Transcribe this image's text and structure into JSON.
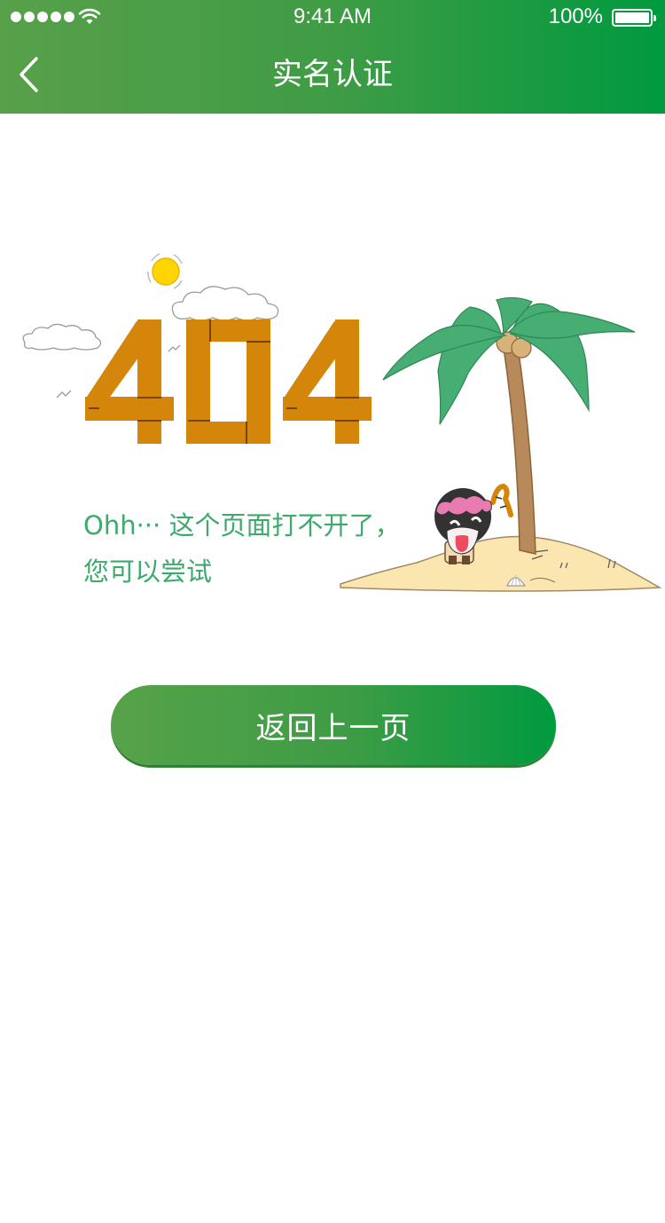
{
  "status_bar": {
    "time": "9:41 AM",
    "battery_percent": "100%",
    "battery_level": 1.0
  },
  "nav": {
    "title": "实名认证",
    "back_icon": "chevron-left-icon"
  },
  "error": {
    "code": "404",
    "message_line1": "Ohh··· 这个页面打不开了，",
    "message_line2": "您可以尝试"
  },
  "actions": {
    "back_label": "返回上一页"
  },
  "colors": {
    "header_gradient_start": "#58a04a",
    "header_gradient_end": "#009a3f",
    "digit_orange": "#d4860a",
    "message_green": "#3daa6c",
    "leaf_green": "#46ad73",
    "trunk_brown": "#b8895a",
    "sand": "#fbe6b0",
    "sun": "#ffd400"
  }
}
